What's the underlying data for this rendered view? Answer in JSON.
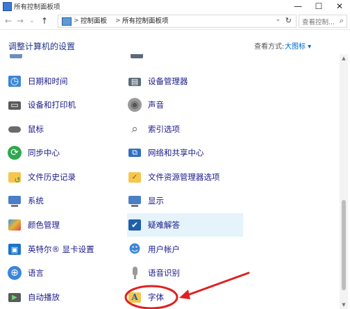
{
  "window": {
    "title": "所有控制面板项",
    "minimize": "—",
    "maximize": "☐",
    "close": "✕"
  },
  "addressbar": {
    "back": "←",
    "forward": "→",
    "recent": "⌄",
    "up": "↑",
    "crumb_sep": ">",
    "crumbs": [
      "控制面板",
      "所有控制面板项"
    ],
    "dropdown": "⌄",
    "refresh": "↻",
    "search_placeholder": "查看控制...",
    "search_icon": "search-icon"
  },
  "header": {
    "title": "调整计算机的设置",
    "view_label": "查看方式:",
    "view_value": "大图标 ▾"
  },
  "items": [
    {
      "label": "日期和时间",
      "icon": "clock-icon",
      "color": "#3b86d8"
    },
    {
      "label": "设备管理器",
      "icon": "device-manager-icon",
      "color": "#5a6a7a"
    },
    {
      "label": "设备和打印机",
      "icon": "printer-icon",
      "color": "#5a5a5a"
    },
    {
      "label": "声音",
      "icon": "speaker-icon",
      "color": "#8a8a8a"
    },
    {
      "label": "鼠标",
      "icon": "mouse-icon",
      "color": "#6b6b6b"
    },
    {
      "label": "索引选项",
      "icon": "index-search-icon",
      "color": "#8a8a8a"
    },
    {
      "label": "同步中心",
      "icon": "sync-icon",
      "color": "#2fa84f"
    },
    {
      "label": "网络和共享中心",
      "icon": "network-icon",
      "color": "#2f6fbf"
    },
    {
      "label": "文件历史记录",
      "icon": "file-history-icon",
      "color": "#f5c64e"
    },
    {
      "label": "文件资源管理器选项",
      "icon": "folder-options-icon",
      "color": "#f5c64e"
    },
    {
      "label": "系统",
      "icon": "system-icon",
      "color": "#4a7ec7"
    },
    {
      "label": "显示",
      "icon": "display-icon",
      "color": "#4a7ec7"
    },
    {
      "label": "颜色管理",
      "icon": "color-management-icon",
      "color": "#3a9ad9"
    },
    {
      "label": "疑难解答",
      "icon": "troubleshooting-icon",
      "color": "#1e5fa8"
    },
    {
      "label": "英特尔® 显卡设置",
      "icon": "intel-graphics-icon",
      "color": "#1a73c9"
    },
    {
      "label": "用户帐户",
      "icon": "user-accounts-icon",
      "color": "#3b86d8"
    },
    {
      "label": "语言",
      "icon": "language-icon",
      "color": "#3b86d8"
    },
    {
      "label": "语音识别",
      "icon": "microphone-icon",
      "color": "#8a8a8a"
    },
    {
      "label": "自动播放",
      "icon": "autoplay-icon",
      "color": "#2fa84f"
    },
    {
      "label": "字体",
      "icon": "fonts-icon",
      "color": "#f5c64e"
    }
  ],
  "glyphs": {
    "clock": "◷",
    "device": "▤",
    "printer": "▭",
    "speaker": "◉",
    "index": "⌕",
    "sync": "⟳",
    "network": "⧉",
    "system": "▣",
    "display": "▭",
    "color": "✦",
    "trouble": "✔",
    "intel": "▣",
    "user": "☻",
    "language": "⊕",
    "mic": "♪",
    "autoplay": "▶",
    "font": "A",
    "history": "↺",
    "folderopt": "✓"
  },
  "annotation": {
    "circle_color": "#e02020",
    "arrow_color": "#e02020"
  }
}
